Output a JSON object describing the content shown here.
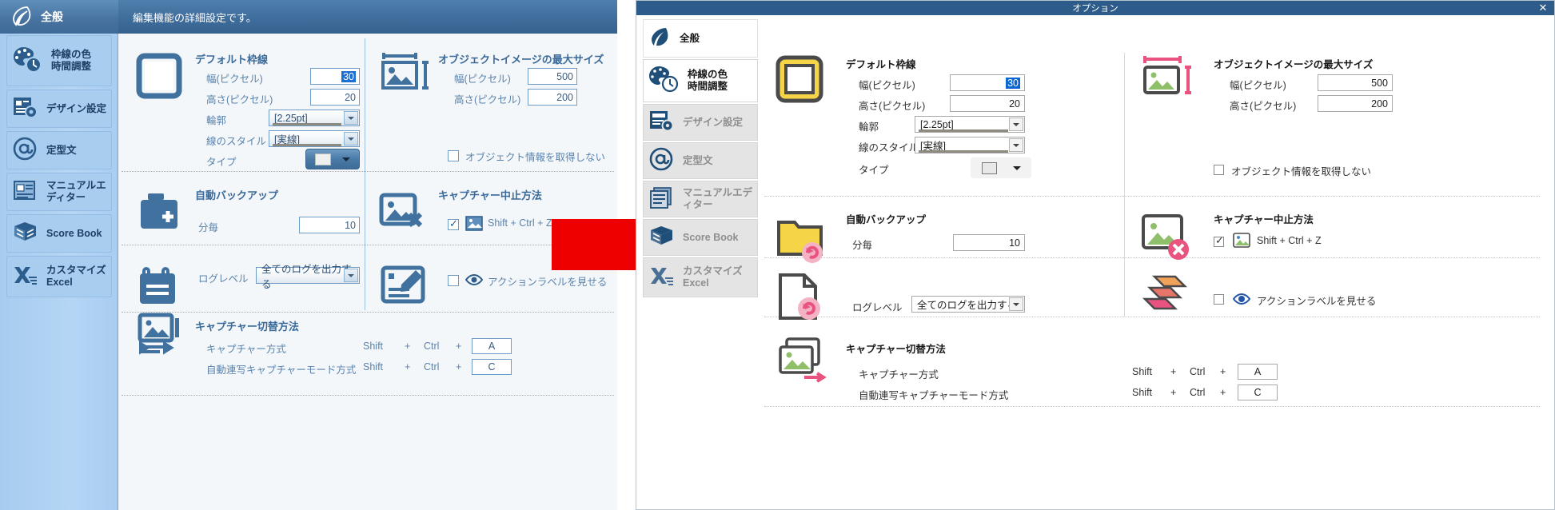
{
  "window_title": "オプション",
  "header": {
    "section_label": "全般",
    "description": "編集機能の詳細設定です。"
  },
  "sidebar": {
    "items": [
      {
        "id": "general",
        "label": "全般",
        "icon": "feather-icon",
        "state": "active"
      },
      {
        "id": "border-color",
        "label": "枠線の色\n時間調整",
        "icon": "palette-clock-icon",
        "state": "normal"
      },
      {
        "id": "design",
        "label": "デザイン設定",
        "icon": "document-gear-icon",
        "state": "normal"
      },
      {
        "id": "template",
        "label": "定型文",
        "icon": "at-sign-icon",
        "state": "normal"
      },
      {
        "id": "manual",
        "label": "マニュアルエディター",
        "icon": "manual-book-icon",
        "state": "normal"
      },
      {
        "id": "scorebook",
        "label": "Score Book",
        "icon": "score-book-icon",
        "state": "normal"
      },
      {
        "id": "excel",
        "label": "カスタマイズ\nExcel",
        "icon": "excel-icon",
        "state": "normal"
      }
    ]
  },
  "groups": {
    "default_border": {
      "title": "デフォルト枠線",
      "icon": "square-border-icon",
      "fields": [
        {
          "label": "幅(ピクセル)",
          "value": "30",
          "selected": true,
          "type": "number"
        },
        {
          "label": "高さ(ピクセル)",
          "value": "20",
          "selected": false,
          "type": "number"
        },
        {
          "label": "輪郭",
          "value": "[2.25pt]",
          "type": "combo"
        },
        {
          "label": "線のスタイル",
          "value": "[実線]",
          "type": "combo"
        },
        {
          "label": "タイプ",
          "value": "",
          "type": "color-button"
        }
      ]
    },
    "object_image_max": {
      "title": "オブジェクトイメージの最大サイズ",
      "icon": "image-size-icon",
      "fields": [
        {
          "label": "幅(ピクセル)",
          "value": "500",
          "type": "number"
        },
        {
          "label": "高さ(ピクセル)",
          "value": "200",
          "type": "number"
        }
      ],
      "checkbox": {
        "label": "オブジェクト情報を取得しない",
        "checked": false
      }
    },
    "auto_backup": {
      "title": "自動バックアップ",
      "icon": "backup-folder-icon",
      "fields": [
        {
          "label": "分毎",
          "value": "10",
          "type": "number"
        }
      ]
    },
    "capture_stop": {
      "title": "キャプチャー中止方法",
      "icon": "image-stop-icon",
      "checkbox": {
        "label": "Shift + Ctrl + Z",
        "checked": true,
        "icon": "image-badge-icon"
      }
    },
    "log_level": {
      "label": "ログレベル",
      "icon": "log-clipboard-icon",
      "value": "全てのログを出力する",
      "type": "combo"
    },
    "action_label": {
      "icon": "edit-note-icon",
      "checkbox": {
        "label": "アクションラベルを見せる",
        "checked": false,
        "icon": "eye-icon"
      }
    },
    "capture_switch": {
      "title": "キャプチャー切替方法",
      "icon": "capture-switch-icon",
      "rows": [
        {
          "label": "キャプチャー方式",
          "mod1": "Shift",
          "plus1": "+",
          "mod2": "Ctrl",
          "plus2": "+",
          "key": "A"
        },
        {
          "label": "自動連写キャプチャーモード方式",
          "mod1": "Shift",
          "plus1": "+",
          "mod2": "Ctrl",
          "plus2": "+",
          "key": "C"
        }
      ]
    }
  },
  "colors": {
    "old_accent": "#3f6d9c",
    "old_sidebar": "#a8cdef",
    "new_title": "#2e5c8a",
    "new_sidebar_active": "#ffffff",
    "new_sidebar_dim": "#e4e4e4",
    "arrow": "#ee0000",
    "selection": "#0a66d0",
    "icon_yellow": "#f5d547",
    "icon_pink": "#e8537f"
  }
}
